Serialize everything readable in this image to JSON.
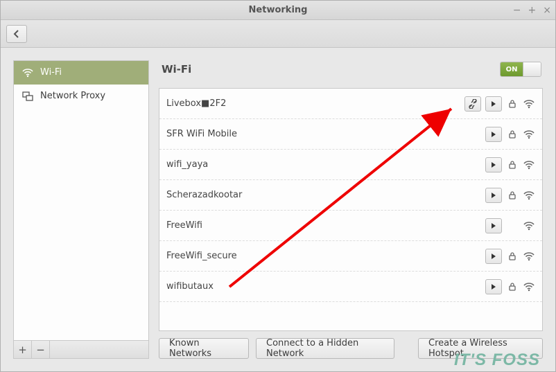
{
  "window": {
    "title": "Networking"
  },
  "sidebar": {
    "items": [
      {
        "label": "Wi-Fi",
        "active": true
      },
      {
        "label": "Network Proxy",
        "active": false
      }
    ]
  },
  "main": {
    "heading": "Wi-Fi",
    "switch": {
      "label": "ON",
      "state": true
    },
    "networks": [
      {
        "name": "Livebox■2F2",
        "settings": true,
        "play": true,
        "lock": true,
        "signal": true
      },
      {
        "name": "SFR WiFi Mobile",
        "settings": false,
        "play": true,
        "lock": true,
        "signal": true
      },
      {
        "name": "wifi_yaya",
        "settings": false,
        "play": true,
        "lock": true,
        "signal": true
      },
      {
        "name": "Scherazadkootar",
        "settings": false,
        "play": true,
        "lock": true,
        "signal": true
      },
      {
        "name": "FreeWifi",
        "settings": false,
        "play": true,
        "lock": false,
        "signal": true
      },
      {
        "name": "FreeWifi_secure",
        "settings": false,
        "play": true,
        "lock": true,
        "signal": true
      },
      {
        "name": "wifibutaux",
        "settings": false,
        "play": true,
        "lock": true,
        "signal": true
      }
    ],
    "buttons": {
      "known": "Known Networks",
      "hidden": "Connect to a Hidden Network",
      "hotspot": "Create a Wireless Hotspot"
    }
  },
  "watermark": "IT'S FOSS"
}
